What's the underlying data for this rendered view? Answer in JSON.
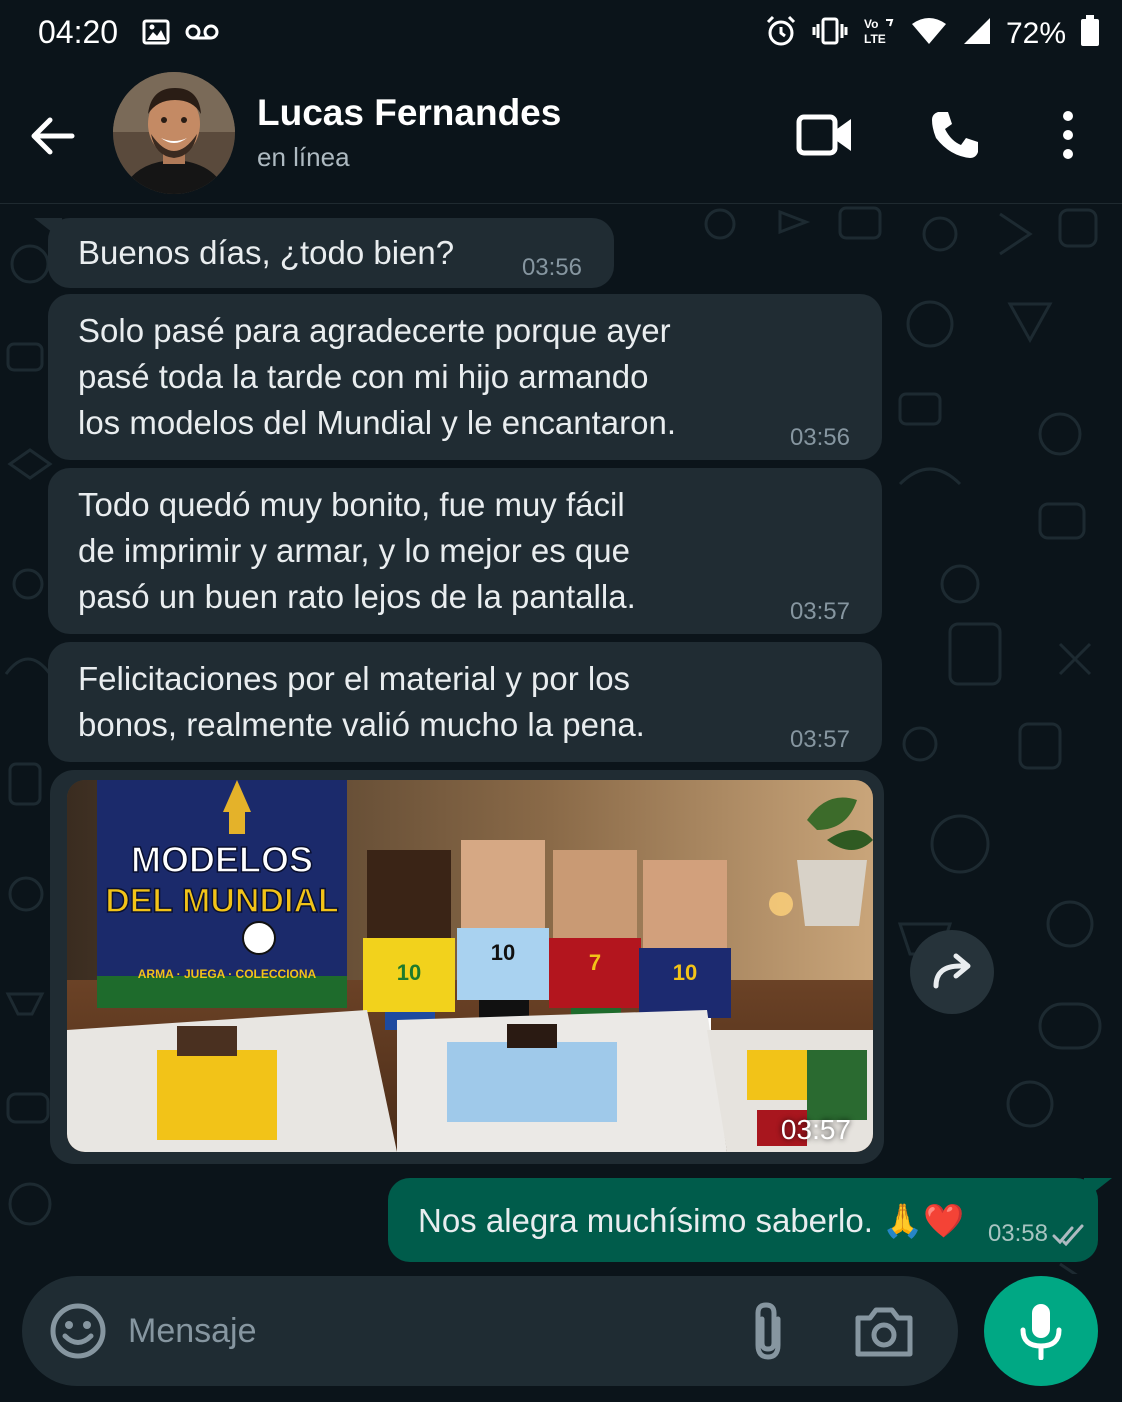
{
  "status_bar": {
    "time": "04:20",
    "battery": "72%",
    "icons": [
      "gallery-icon",
      "voicemail-icon",
      "alarm-icon",
      "vibrate-icon",
      "volte-icon",
      "wifi-icon",
      "signal-icon",
      "battery-icon"
    ]
  },
  "header": {
    "contact_name": "Lucas Fernandes",
    "contact_status": "en línea",
    "icons": [
      "back-arrow-icon",
      "video-call-icon",
      "voice-call-icon",
      "more-options-icon"
    ]
  },
  "messages": [
    {
      "direction": "incoming",
      "type": "text",
      "text": "Buenos días, ¿todo bien?",
      "time": "03:56"
    },
    {
      "direction": "incoming",
      "type": "text",
      "lines": [
        "Solo pasé para agradecerte porque ayer",
        "pasé toda la tarde con mi hijo armando",
        "los modelos del Mundial y le encantaron."
      ],
      "time": "03:56"
    },
    {
      "direction": "incoming",
      "type": "text",
      "lines": [
        "Todo quedó muy bonito, fue muy fácil",
        "de imprimir y armar, y lo mejor es que",
        "pasó un buen rato lejos de la pantalla."
      ],
      "time": "03:57"
    },
    {
      "direction": "incoming",
      "type": "text",
      "lines": [
        "Felicitaciones por el material y por los",
        "bonos, realmente valió mucho la pena."
      ],
      "time": "03:57"
    },
    {
      "direction": "incoming",
      "type": "image",
      "time": "03:57",
      "image_text": {
        "box_title_1": "MODELOS",
        "box_title_2": "DEL MUNDIAL",
        "box_tagline": "ARMA · JUEGA · COLECCIONA",
        "jersey_numbers": [
          "10",
          "10",
          "7",
          "10"
        ]
      }
    },
    {
      "direction": "outgoing",
      "type": "text",
      "text": "Nos alegra muchísimo saberlo. 🙏❤️",
      "time": "03:58",
      "status": "read"
    }
  ],
  "composer": {
    "placeholder": "Mensaje",
    "icons": [
      "emoji-icon",
      "attach-icon",
      "camera-icon",
      "mic-icon"
    ]
  },
  "colors": {
    "background": "#0b141a",
    "incoming_bubble": "#202c33",
    "outgoing_bubble": "#005c4b",
    "accent": "#00a884",
    "secondary_text": "#8696a0"
  }
}
